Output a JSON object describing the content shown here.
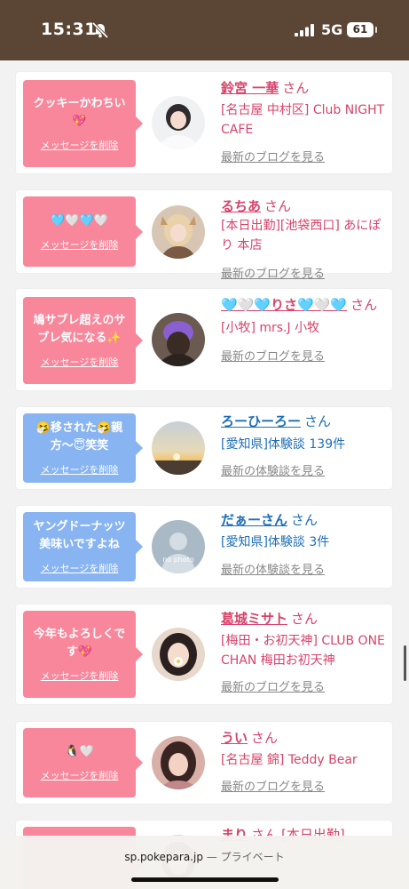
{
  "status_bar": {
    "time": "15:31",
    "network": "5G",
    "battery": "61"
  },
  "cards": [
    {
      "message": "クッキーかわちい💖",
      "delete": "メッセージを削除",
      "name": "鈴宮 一華",
      "san": "さん",
      "detail": "[名古屋 中村区] Club NIGHT CAFE",
      "link": "最新のブログを見る",
      "bubble_color": "pink"
    },
    {
      "message": "🩵🤍🩵🤍",
      "delete": "メッセージを削除",
      "name": "るちあ",
      "san": "さん",
      "detail": "[本日出勤][池袋西口] あにぽり 本店",
      "link": "最新のブログを見る",
      "bubble_color": "pink"
    },
    {
      "message": "鳩サブレ超えのサブレ気になる✨",
      "delete": "メッセージを削除",
      "name": "🩵🤍🩵りさ🩵🤍🩵",
      "san": "さん",
      "detail": "[小牧] mrs.J 小牧",
      "link": "最新のブログを見る",
      "bubble_color": "pink"
    },
    {
      "message": "🤧移された🤧親方〜😇笑笑",
      "delete": "メッセージを削除",
      "name": "ろーひーろー",
      "san": "さん",
      "detail": "[愛知県]体験談 139件",
      "link": "最新の体験談を見る",
      "bubble_color": "blue"
    },
    {
      "message": "ヤングドーナッツ美味いですよね",
      "delete": "メッセージを削除",
      "name": "だぁーさん",
      "san": "さん",
      "detail": "[愛知県]体験談 3件",
      "link": "最新の体験談を見る",
      "bubble_color": "blue",
      "avatar_text": "no photo"
    },
    {
      "message": "今年もよろしくです💖",
      "delete": "メッセージを削除",
      "name": "葛城ミサト",
      "san": "さん",
      "detail": "[梅田・お初天神] CLUB ONE CHAN 梅田お初天神",
      "link": "最新のブログを見る",
      "bubble_color": "pink"
    },
    {
      "message": "🐧🤍",
      "delete": "メッセージを削除",
      "name": "うい",
      "san": "さん",
      "detail": "[名古屋 錦] Teddy Bear",
      "link": "最新のブログを見る",
      "bubble_color": "pink"
    },
    {
      "message": "",
      "delete": "",
      "name": "まり",
      "san": "さん",
      "detail": "[本日出勤]",
      "link": "",
      "bubble_color": "pink"
    }
  ],
  "bottom_bar": {
    "domain": "sp.pokepara.jp",
    "mode": "— プライベート"
  }
}
